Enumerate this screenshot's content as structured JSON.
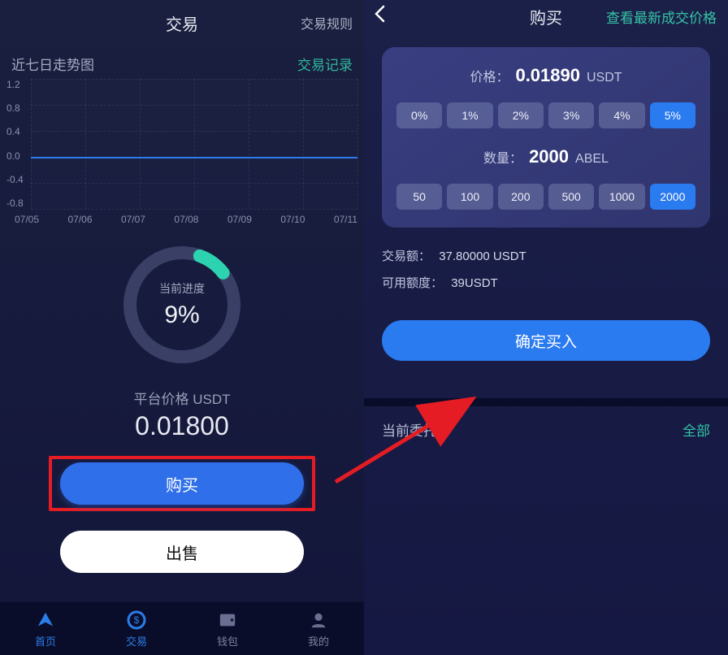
{
  "left": {
    "header": {
      "title": "交易",
      "right": "交易规则"
    },
    "sub": {
      "left": "近七日走势图",
      "right": "交易记录"
    },
    "chart": {
      "y_ticks": [
        "1.2",
        "0.8",
        "0.4",
        "0.0",
        "-0.4",
        "-0.8"
      ],
      "x_ticks": [
        "07/05",
        "07/06",
        "07/07",
        "07/08",
        "07/09",
        "07/10",
        "07/11"
      ]
    },
    "progress": {
      "label": "当前进度",
      "value": "9%"
    },
    "price": {
      "label": "平台价格 USDT",
      "value": "0.01800"
    },
    "btn_buy": "购买",
    "btn_sell": "出售",
    "tabs": [
      "首页",
      "交易",
      "钱包",
      "我的"
    ]
  },
  "right": {
    "header": {
      "title": "购买",
      "right": "查看最新成交价格"
    },
    "form": {
      "price_label": "价格：",
      "price_value": "0.01890",
      "price_unit": "USDT",
      "pct_options": [
        "0%",
        "1%",
        "2%",
        "3%",
        "4%",
        "5%"
      ],
      "pct_selected": 5,
      "qty_label": "数量：",
      "qty_value": "2000",
      "qty_unit": "ABEL",
      "amt_options": [
        "50",
        "100",
        "200",
        "500",
        "1000",
        "2000"
      ],
      "amt_selected": 5
    },
    "info": {
      "amount_label": "交易额：",
      "amount_value": "37.80000 USDT",
      "avail_label": "可用额度：",
      "avail_value": "39USDT"
    },
    "btn_confirm": "确定买入",
    "orders": {
      "title": "当前委托",
      "all": "全部"
    }
  },
  "chart_data": {
    "type": "line",
    "title": "近七日走势图",
    "x": [
      "07/05",
      "07/06",
      "07/07",
      "07/08",
      "07/09",
      "07/10",
      "07/11"
    ],
    "y": [
      0.0,
      0.0,
      0.0,
      0.0,
      0.0,
      0.0,
      0.0
    ],
    "ylabel": "",
    "ylim": [
      -0.8,
      1.2
    ]
  }
}
